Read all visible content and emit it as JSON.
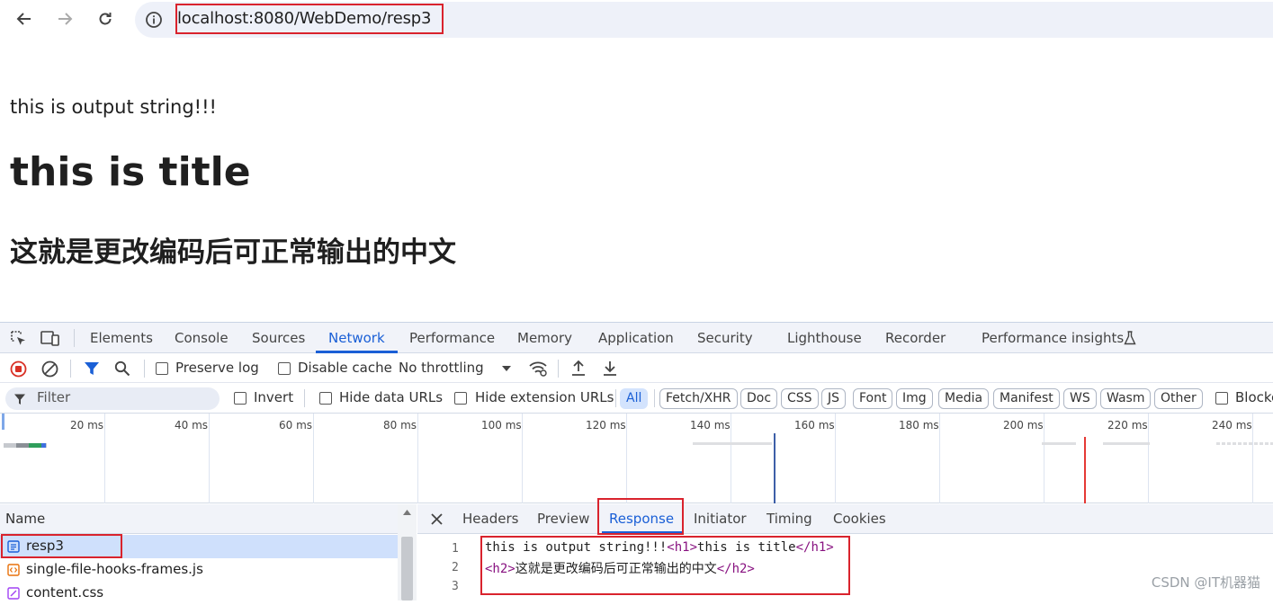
{
  "browser": {
    "url": "localhost:8080/WebDemo/resp3"
  },
  "page": {
    "line": "this is output string!!!",
    "title": "this is title",
    "subtitle": "这就是更改编码后可正常输出的中文"
  },
  "devtools": {
    "tabs": [
      "Elements",
      "Console",
      "Sources",
      "Network",
      "Performance",
      "Memory",
      "Application",
      "Security",
      "Lighthouse",
      "Recorder",
      "Performance insights"
    ],
    "active_tab": "Network",
    "toolbar": {
      "preserve_log": "Preserve log",
      "disable_cache": "Disable cache",
      "throttling": "No throttling"
    },
    "filter": {
      "placeholder": "Filter",
      "invert": "Invert",
      "hide_data_urls": "Hide data URLs",
      "hide_extension_urls": "Hide extension URLs",
      "types": [
        "All",
        "Fetch/XHR",
        "Doc",
        "CSS",
        "JS",
        "Font",
        "Img",
        "Media",
        "Manifest",
        "WS",
        "Wasm",
        "Other"
      ],
      "blocked": "Blocke"
    },
    "timeline_ticks": [
      "20 ms",
      "40 ms",
      "60 ms",
      "80 ms",
      "100 ms",
      "120 ms",
      "140 ms",
      "160 ms",
      "180 ms",
      "200 ms",
      "220 ms",
      "240 ms"
    ],
    "requests": {
      "header": "Name",
      "rows": [
        "resp3",
        "single-file-hooks-frames.js",
        "content.css"
      ]
    },
    "detail_tabs": [
      "Headers",
      "Preview",
      "Response",
      "Initiator",
      "Timing",
      "Cookies"
    ],
    "active_detail_tab": "Response",
    "response": {
      "line_numbers": [
        "1",
        "2",
        "3"
      ],
      "line1": {
        "text1": "this is output string!!!",
        "tag1": "<h1>",
        "text2": "this is title",
        "tag2": "</h1>"
      },
      "line2": {
        "tag1": "<h2>",
        "text1": "这就是更改编码后可正常输出的中文",
        "tag2": "</h2>"
      }
    }
  },
  "watermark": "CSDN @IT机器猫",
  "colors": {
    "accent": "#1a5fd6",
    "highlight_box": "#d9232d",
    "record_red": "#d93025"
  }
}
